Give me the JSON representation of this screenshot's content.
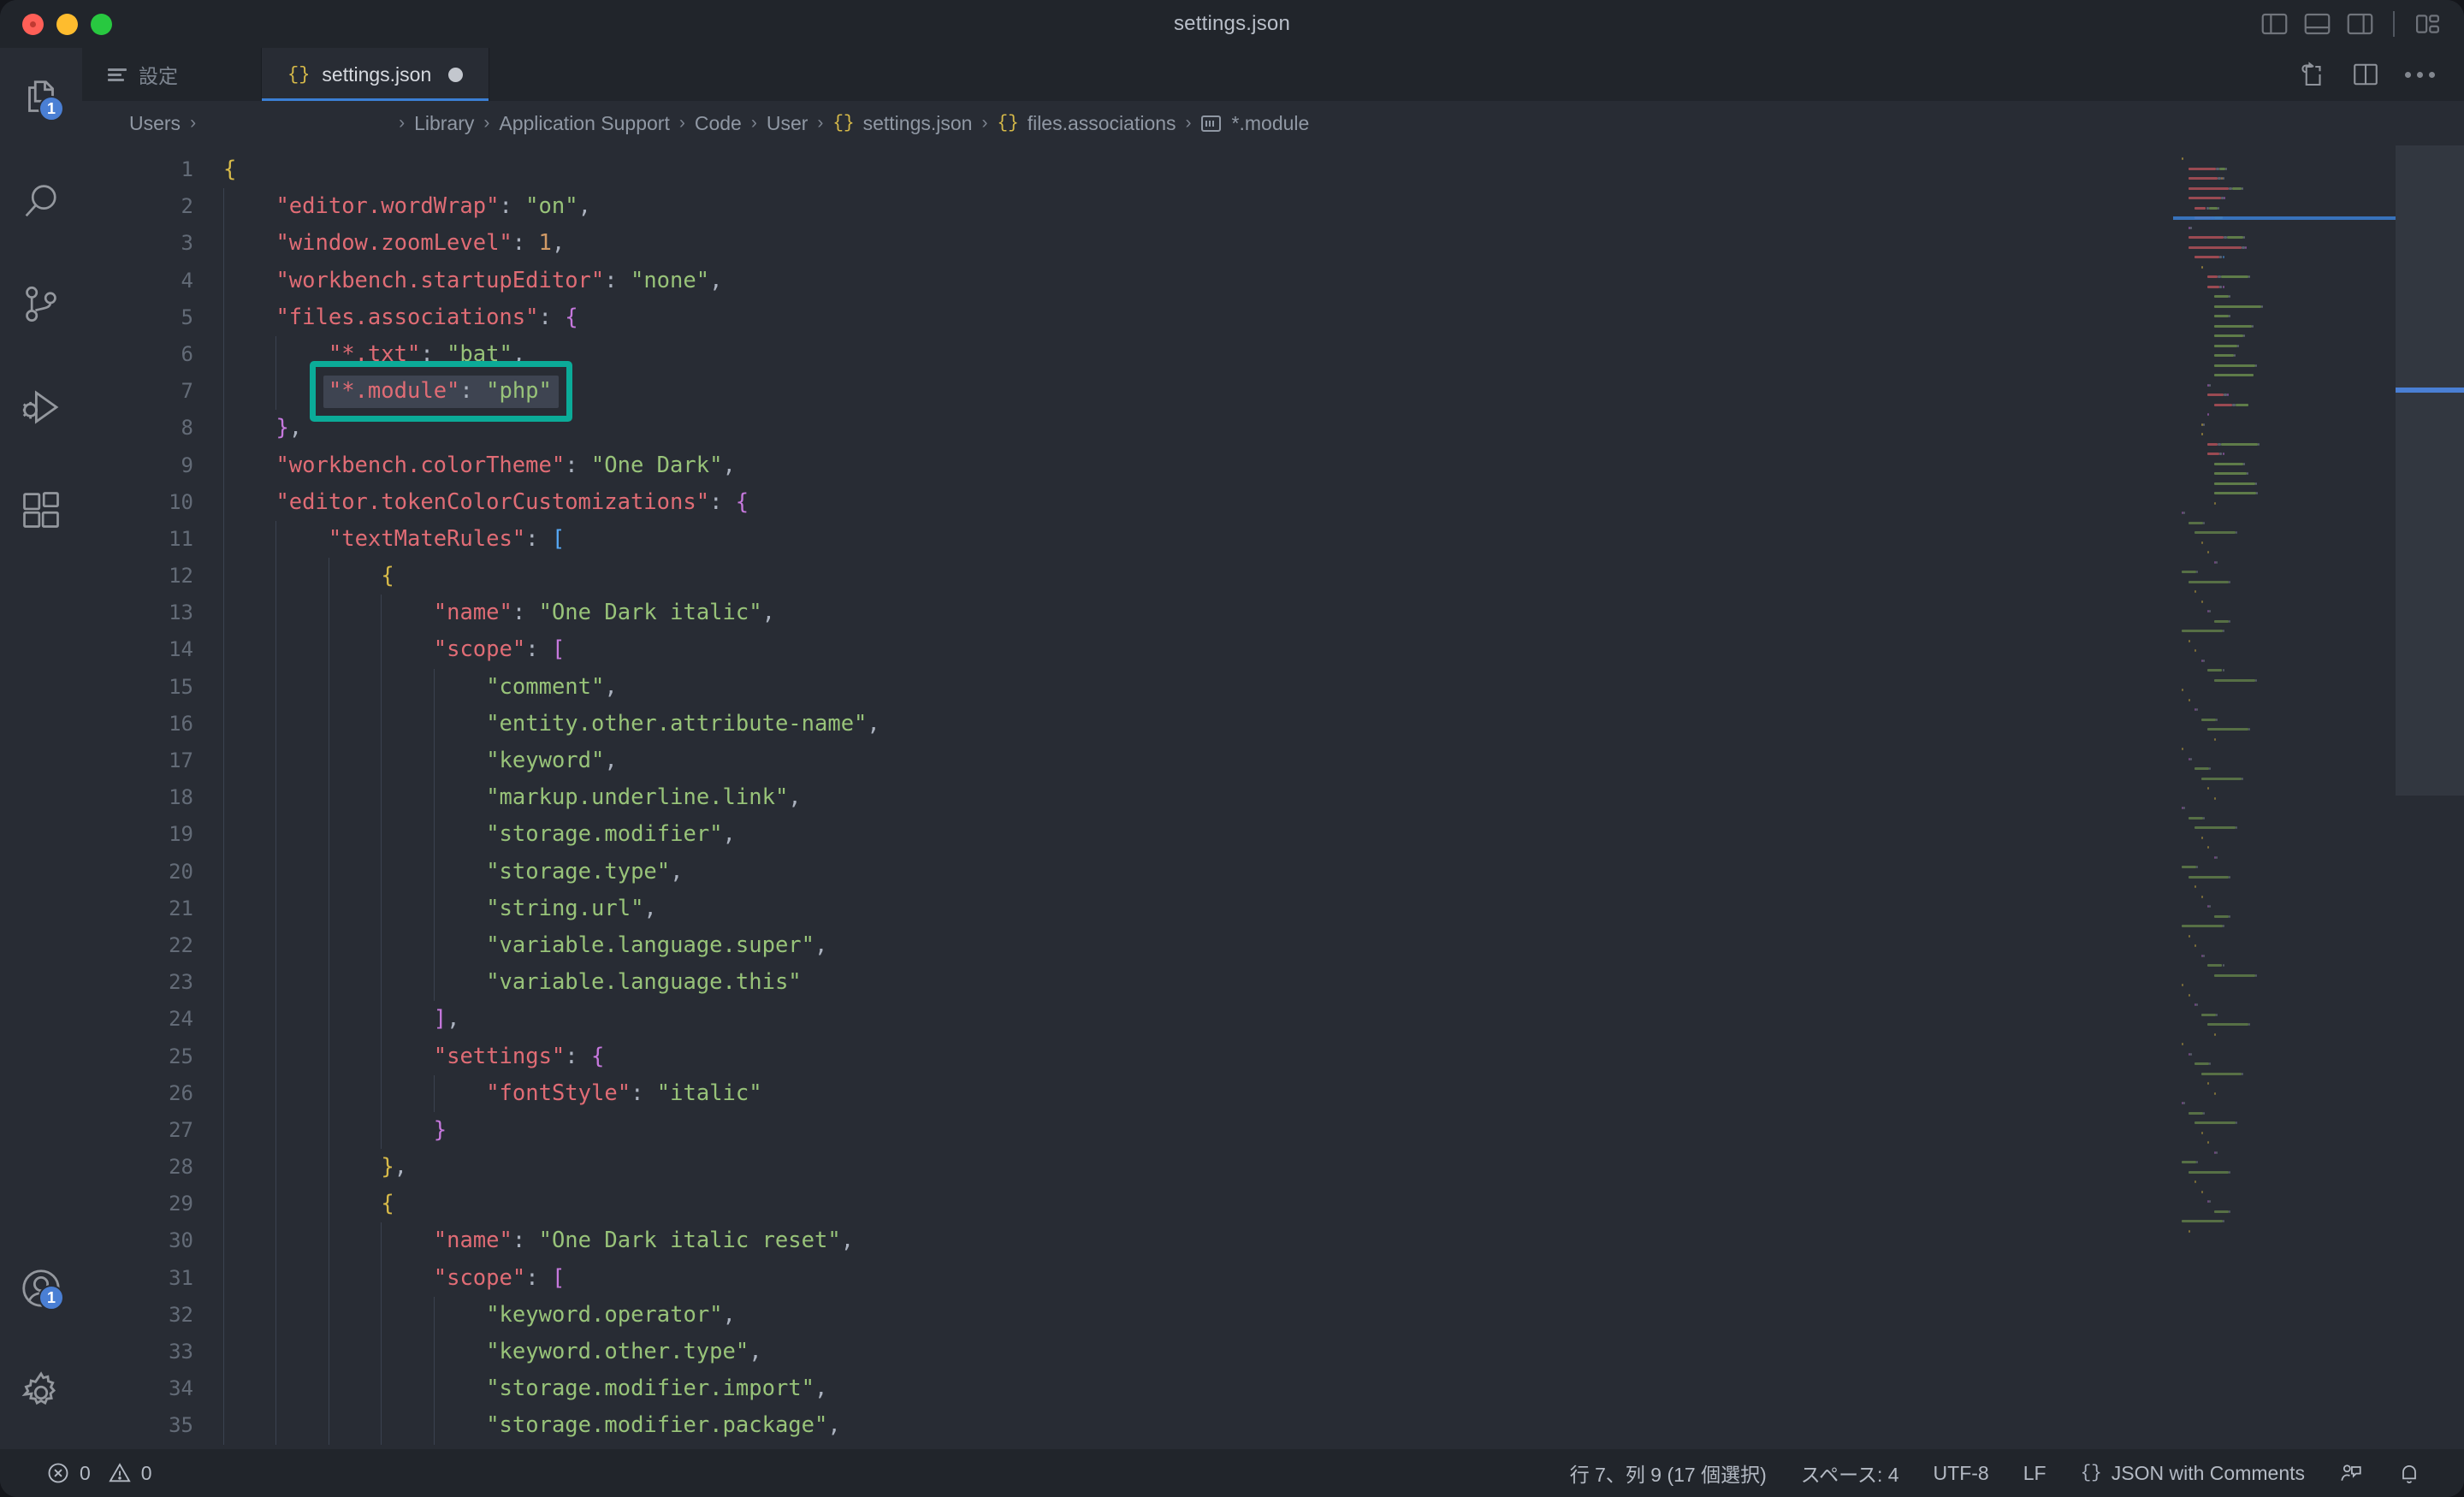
{
  "window": {
    "title": "settings.json",
    "traffic_lights": [
      "close-button",
      "minimize-button",
      "maximize-button"
    ],
    "layout_icons": [
      "toggle-primary-sidebar-icon",
      "toggle-panel-icon",
      "toggle-secondary-sidebar-icon",
      "customize-layout-icon"
    ]
  },
  "activitybar": {
    "top_items": [
      {
        "name": "explorer",
        "icon": "files-icon",
        "badge": "1"
      },
      {
        "name": "search",
        "icon": "search-icon",
        "badge": ""
      },
      {
        "name": "source-control",
        "icon": "source-control-icon",
        "badge": ""
      },
      {
        "name": "run-and-debug",
        "icon": "run-debug-icon",
        "badge": ""
      },
      {
        "name": "extensions",
        "icon": "extensions-icon",
        "badge": ""
      }
    ],
    "bottom_items": [
      {
        "name": "accounts",
        "icon": "account-icon",
        "badge": "1"
      },
      {
        "name": "manage",
        "icon": "gear-icon",
        "badge": ""
      }
    ]
  },
  "tabs": [
    {
      "label": "設定",
      "icon": "settings-lines-icon",
      "active": false,
      "dirty": false
    },
    {
      "label": "settings.json",
      "icon": "json-braces-icon",
      "active": true,
      "dirty": true
    }
  ],
  "editor_actions": [
    "open-changes-icon",
    "split-editor-icon",
    "more-actions-icon"
  ],
  "breadcrumb": {
    "items": [
      {
        "label": "Users",
        "icon": ""
      },
      {
        "label": "",
        "icon": ""
      },
      {
        "label": "Library",
        "icon": ""
      },
      {
        "label": "Application Support",
        "icon": ""
      },
      {
        "label": "Code",
        "icon": ""
      },
      {
        "label": "User",
        "icon": ""
      },
      {
        "label": "settings.json",
        "icon": "json-braces-icon"
      },
      {
        "label": "files.associations",
        "icon": "json-braces-icon"
      },
      {
        "label": "*.module",
        "icon": "symbol-string-icon"
      }
    ],
    "separator": "›"
  },
  "code": {
    "first_line": 1,
    "last_line": 35,
    "selected_line": 7,
    "lines": [
      {
        "n": 1,
        "indent": 0,
        "tokens": [
          {
            "t": "{",
            "c": "b1"
          }
        ]
      },
      {
        "n": 2,
        "indent": 1,
        "tokens": [
          {
            "t": "\"editor.wordWrap\"",
            "c": "k"
          },
          {
            "t": ": ",
            "c": "p"
          },
          {
            "t": "\"on\"",
            "c": "s"
          },
          {
            "t": ",",
            "c": "p"
          }
        ]
      },
      {
        "n": 3,
        "indent": 1,
        "tokens": [
          {
            "t": "\"window.zoomLevel\"",
            "c": "k"
          },
          {
            "t": ": ",
            "c": "p"
          },
          {
            "t": "1",
            "c": "n"
          },
          {
            "t": ",",
            "c": "p"
          }
        ]
      },
      {
        "n": 4,
        "indent": 1,
        "tokens": [
          {
            "t": "\"workbench.startupEditor\"",
            "c": "k"
          },
          {
            "t": ": ",
            "c": "p"
          },
          {
            "t": "\"none\"",
            "c": "s"
          },
          {
            "t": ",",
            "c": "p"
          }
        ]
      },
      {
        "n": 5,
        "indent": 1,
        "tokens": [
          {
            "t": "\"files.associations\"",
            "c": "k"
          },
          {
            "t": ": ",
            "c": "p"
          },
          {
            "t": "{",
            "c": "b2"
          }
        ]
      },
      {
        "n": 6,
        "indent": 2,
        "tokens": [
          {
            "t": "\"*.txt\"",
            "c": "k"
          },
          {
            "t": ": ",
            "c": "p"
          },
          {
            "t": "\"bat\"",
            "c": "s"
          },
          {
            "t": ",",
            "c": "p"
          }
        ]
      },
      {
        "n": 7,
        "indent": 2,
        "tokens": [
          {
            "t": "\"*.module\"",
            "c": "k"
          },
          {
            "t": ": ",
            "c": "p"
          },
          {
            "t": "\"php\"",
            "c": "s"
          }
        ]
      },
      {
        "n": 8,
        "indent": 1,
        "tokens": [
          {
            "t": "}",
            "c": "b2"
          },
          {
            "t": ",",
            "c": "p"
          }
        ]
      },
      {
        "n": 9,
        "indent": 1,
        "tokens": [
          {
            "t": "\"workbench.colorTheme\"",
            "c": "k"
          },
          {
            "t": ": ",
            "c": "p"
          },
          {
            "t": "\"One Dark\"",
            "c": "s"
          },
          {
            "t": ",",
            "c": "p"
          }
        ]
      },
      {
        "n": 10,
        "indent": 1,
        "tokens": [
          {
            "t": "\"editor.tokenColorCustomizations\"",
            "c": "k"
          },
          {
            "t": ": ",
            "c": "p"
          },
          {
            "t": "{",
            "c": "b2"
          }
        ]
      },
      {
        "n": 11,
        "indent": 2,
        "tokens": [
          {
            "t": "\"textMateRules\"",
            "c": "k"
          },
          {
            "t": ": ",
            "c": "p"
          },
          {
            "t": "[",
            "c": "b3"
          }
        ]
      },
      {
        "n": 12,
        "indent": 3,
        "tokens": [
          {
            "t": "{",
            "c": "b1"
          }
        ]
      },
      {
        "n": 13,
        "indent": 4,
        "tokens": [
          {
            "t": "\"name\"",
            "c": "k"
          },
          {
            "t": ": ",
            "c": "p"
          },
          {
            "t": "\"One Dark italic\"",
            "c": "s"
          },
          {
            "t": ",",
            "c": "p"
          }
        ]
      },
      {
        "n": 14,
        "indent": 4,
        "tokens": [
          {
            "t": "\"scope\"",
            "c": "k"
          },
          {
            "t": ": ",
            "c": "p"
          },
          {
            "t": "[",
            "c": "b2"
          }
        ]
      },
      {
        "n": 15,
        "indent": 5,
        "tokens": [
          {
            "t": "\"comment\"",
            "c": "s"
          },
          {
            "t": ",",
            "c": "p"
          }
        ]
      },
      {
        "n": 16,
        "indent": 5,
        "tokens": [
          {
            "t": "\"entity.other.attribute-name\"",
            "c": "s"
          },
          {
            "t": ",",
            "c": "p"
          }
        ]
      },
      {
        "n": 17,
        "indent": 5,
        "tokens": [
          {
            "t": "\"keyword\"",
            "c": "s"
          },
          {
            "t": ",",
            "c": "p"
          }
        ]
      },
      {
        "n": 18,
        "indent": 5,
        "tokens": [
          {
            "t": "\"markup.underline.link\"",
            "c": "s"
          },
          {
            "t": ",",
            "c": "p"
          }
        ]
      },
      {
        "n": 19,
        "indent": 5,
        "tokens": [
          {
            "t": "\"storage.modifier\"",
            "c": "s"
          },
          {
            "t": ",",
            "c": "p"
          }
        ]
      },
      {
        "n": 20,
        "indent": 5,
        "tokens": [
          {
            "t": "\"storage.type\"",
            "c": "s"
          },
          {
            "t": ",",
            "c": "p"
          }
        ]
      },
      {
        "n": 21,
        "indent": 5,
        "tokens": [
          {
            "t": "\"string.url\"",
            "c": "s"
          },
          {
            "t": ",",
            "c": "p"
          }
        ]
      },
      {
        "n": 22,
        "indent": 5,
        "tokens": [
          {
            "t": "\"variable.language.super\"",
            "c": "s"
          },
          {
            "t": ",",
            "c": "p"
          }
        ]
      },
      {
        "n": 23,
        "indent": 5,
        "tokens": [
          {
            "t": "\"variable.language.this\"",
            "c": "s"
          }
        ]
      },
      {
        "n": 24,
        "indent": 4,
        "tokens": [
          {
            "t": "]",
            "c": "b2"
          },
          {
            "t": ",",
            "c": "p"
          }
        ]
      },
      {
        "n": 25,
        "indent": 4,
        "tokens": [
          {
            "t": "\"settings\"",
            "c": "k"
          },
          {
            "t": ": ",
            "c": "p"
          },
          {
            "t": "{",
            "c": "b2"
          }
        ]
      },
      {
        "n": 26,
        "indent": 5,
        "tokens": [
          {
            "t": "\"fontStyle\"",
            "c": "k"
          },
          {
            "t": ": ",
            "c": "p"
          },
          {
            "t": "\"italic\"",
            "c": "s"
          }
        ]
      },
      {
        "n": 27,
        "indent": 4,
        "tokens": [
          {
            "t": "}",
            "c": "b2"
          }
        ]
      },
      {
        "n": 28,
        "indent": 3,
        "tokens": [
          {
            "t": "}",
            "c": "b1"
          },
          {
            "t": ",",
            "c": "p"
          }
        ]
      },
      {
        "n": 29,
        "indent": 3,
        "tokens": [
          {
            "t": "{",
            "c": "b1"
          }
        ]
      },
      {
        "n": 30,
        "indent": 4,
        "tokens": [
          {
            "t": "\"name\"",
            "c": "k"
          },
          {
            "t": ": ",
            "c": "p"
          },
          {
            "t": "\"One Dark italic reset\"",
            "c": "s"
          },
          {
            "t": ",",
            "c": "p"
          }
        ]
      },
      {
        "n": 31,
        "indent": 4,
        "tokens": [
          {
            "t": "\"scope\"",
            "c": "k"
          },
          {
            "t": ": ",
            "c": "p"
          },
          {
            "t": "[",
            "c": "b2"
          }
        ]
      },
      {
        "n": 32,
        "indent": 5,
        "tokens": [
          {
            "t": "\"keyword.operator\"",
            "c": "s"
          },
          {
            "t": ",",
            "c": "p"
          }
        ]
      },
      {
        "n": 33,
        "indent": 5,
        "tokens": [
          {
            "t": "\"keyword.other.type\"",
            "c": "s"
          },
          {
            "t": ",",
            "c": "p"
          }
        ]
      },
      {
        "n": 34,
        "indent": 5,
        "tokens": [
          {
            "t": "\"storage.modifier.import\"",
            "c": "s"
          },
          {
            "t": ",",
            "c": "p"
          }
        ]
      },
      {
        "n": 35,
        "indent": 5,
        "tokens": [
          {
            "t": "\"storage.modifier.package\"",
            "c": "s"
          },
          {
            "t": ",",
            "c": "p"
          }
        ]
      }
    ]
  },
  "annotation": {
    "color": "#0bab98",
    "target_line": 7,
    "target_text": "\"*.module\": \"php\""
  },
  "statusbar": {
    "errors_icon": "error-circle-icon",
    "errors": "0",
    "warnings_icon": "warning-triangle-icon",
    "warnings": "0",
    "cursor_position": "行 7、列 9 (17 個選択)",
    "indentation": "スペース: 4",
    "encoding": "UTF-8",
    "eol": "LF",
    "language_icon": "json-braces-icon",
    "language": "JSON with Comments",
    "feedback_icon": "feedback-icon",
    "notifications_icon": "bell-icon"
  },
  "colors": {
    "editor_bg": "#282c34",
    "chrome_bg": "#21252b",
    "accent_blue": "#4a7fd4",
    "token_key": "#e06c75",
    "token_string": "#98c379",
    "token_number": "#d19a66",
    "bracket_yellow": "#d7ba49",
    "bracket_magenta": "#c678dd",
    "bracket_blue": "#56a8f5",
    "annotation_teal": "#0bab98",
    "selection": "#3e4451"
  }
}
